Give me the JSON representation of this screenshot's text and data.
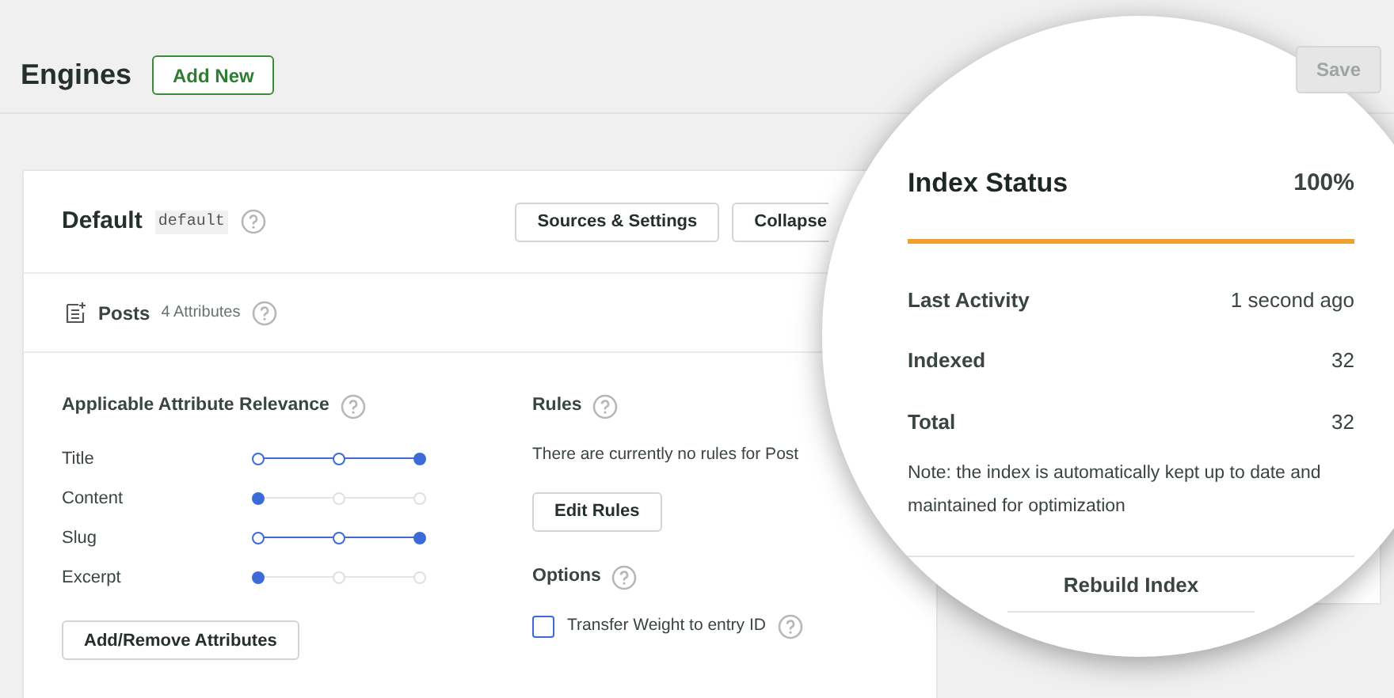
{
  "header": {
    "title": "Engines",
    "add_button": "Add New",
    "save_button": {
      "label": "Save",
      "disabled": true
    }
  },
  "engine": {
    "name": "Default",
    "slug": "default",
    "buttons": [
      "Sources & Settings",
      "Collapse"
    ]
  },
  "source": {
    "name": "Posts",
    "attributes_count": "4 Attributes"
  },
  "relevance": {
    "heading": "Applicable Attribute Relevance",
    "attributes": [
      {
        "label": "Title",
        "level": 1
      },
      {
        "label": "Content",
        "level": 0
      },
      {
        "label": "Slug",
        "level": 1
      },
      {
        "label": "Excerpt",
        "level": 0
      }
    ],
    "button": "Add/Remove Attributes"
  },
  "rules": {
    "heading": "Rules",
    "text": "There are currently no rules for Post",
    "button": "Edit Rules"
  },
  "options": {
    "heading": "Options",
    "items": [
      {
        "label": "Transfer Weight to entry ID",
        "checked": false
      }
    ]
  },
  "index_status": {
    "title": "Index Status",
    "percent": "100%",
    "level": 1,
    "rows": [
      {
        "label": "Last Activity",
        "value": "1 second ago"
      },
      {
        "label": "Indexed",
        "value": "32"
      },
      {
        "label": "Total",
        "value": "32"
      }
    ],
    "note": "Note: the index is automatically kept up to date and maintained for optimization",
    "button": "Rebuild Index"
  }
}
